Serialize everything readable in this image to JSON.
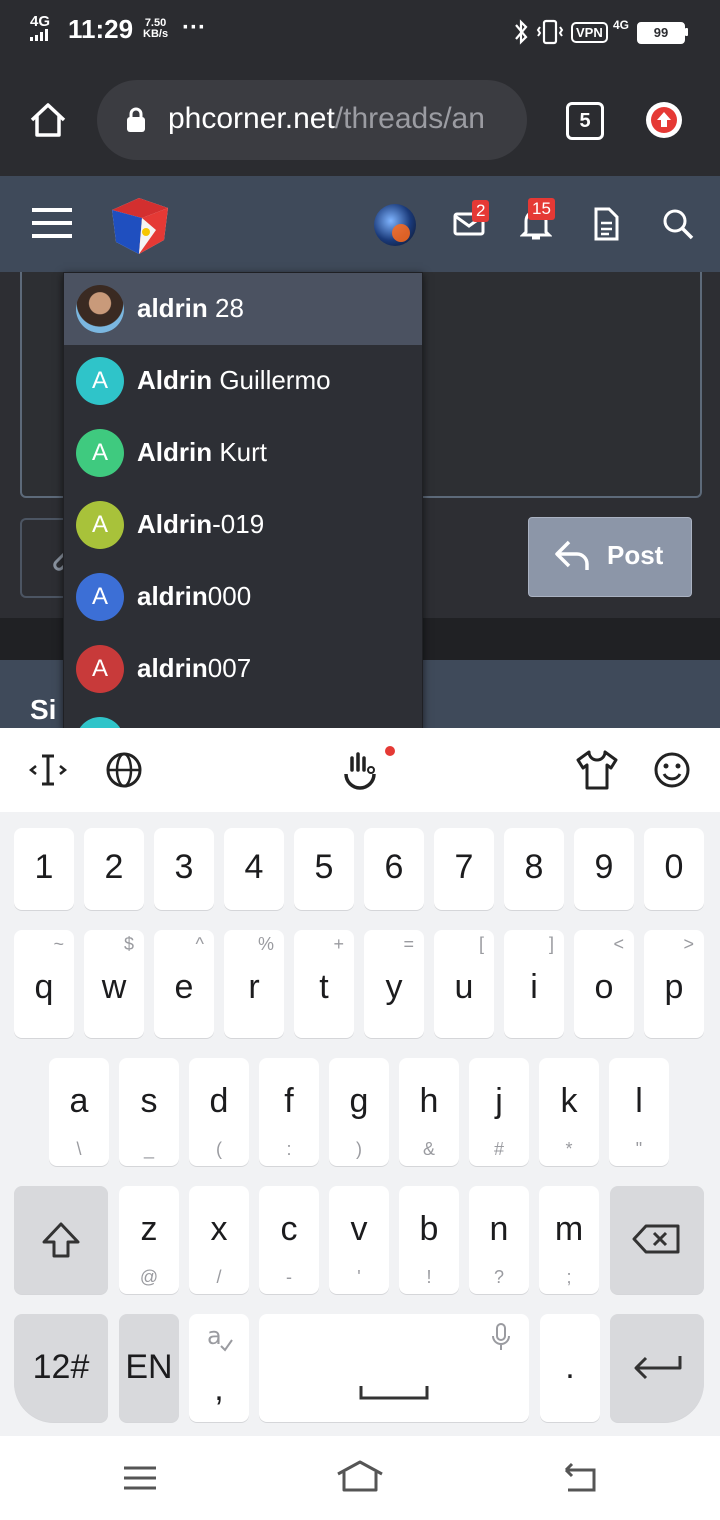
{
  "status_bar": {
    "signal_label": "4G",
    "time": "11:29",
    "speed_value": "7.50",
    "speed_unit": "KB/s",
    "more": "···",
    "vpn": "VPN",
    "network": "4G",
    "battery": "99"
  },
  "browser": {
    "url_domain": "phcorner.net",
    "url_path": "/threads/an",
    "tab_count": "5"
  },
  "site_header": {
    "messages_badge": "2",
    "alerts_badge": "15"
  },
  "editor": {
    "post_label": "Post",
    "similar_label": "Si"
  },
  "mentions": [
    {
      "bold": "aldrin",
      "rest": " 28",
      "initial": "",
      "avatar_color": "#7a5a48",
      "has_photo": true
    },
    {
      "bold": "Aldrin",
      "rest": " Guillermo",
      "initial": "A",
      "avatar_color": "#2fc4c9"
    },
    {
      "bold": "Aldrin",
      "rest": " Kurt",
      "initial": "A",
      "avatar_color": "#3fca7f"
    },
    {
      "bold": "Aldrin",
      "rest": "-019",
      "initial": "A",
      "avatar_color": "#a8c23a"
    },
    {
      "bold": "aldrin",
      "rest": "000",
      "initial": "A",
      "avatar_color": "#3c6fd6"
    },
    {
      "bold": "aldrin",
      "rest": "007",
      "initial": "A",
      "avatar_color": "#c83a3a"
    },
    {
      "bold": "",
      "rest": "",
      "initial": "",
      "avatar_color": "#2fc4c9"
    }
  ],
  "keyboard": {
    "numbers": [
      "1",
      "2",
      "3",
      "4",
      "5",
      "6",
      "7",
      "8",
      "9",
      "0"
    ],
    "row1": [
      {
        "k": "q",
        "s": "~"
      },
      {
        "k": "w",
        "s": "$"
      },
      {
        "k": "e",
        "s": "^"
      },
      {
        "k": "r",
        "s": "%"
      },
      {
        "k": "t",
        "s": "+"
      },
      {
        "k": "y",
        "s": "="
      },
      {
        "k": "u",
        "s": "["
      },
      {
        "k": "i",
        "s": "]"
      },
      {
        "k": "o",
        "s": "<"
      },
      {
        "k": "p",
        "s": ">"
      }
    ],
    "row2": [
      {
        "k": "a",
        "s": "\\"
      },
      {
        "k": "s",
        "s": "_"
      },
      {
        "k": "d",
        "s": "("
      },
      {
        "k": "f",
        "s": ":"
      },
      {
        "k": "g",
        "s": ")"
      },
      {
        "k": "h",
        "s": "&"
      },
      {
        "k": "j",
        "s": "#"
      },
      {
        "k": "k",
        "s": "*"
      },
      {
        "k": "l",
        "s": "\""
      }
    ],
    "row3": [
      {
        "k": "z",
        "s": "@"
      },
      {
        "k": "x",
        "s": "/"
      },
      {
        "k": "c",
        "s": "-"
      },
      {
        "k": "v",
        "s": "'"
      },
      {
        "k": "b",
        "s": "!"
      },
      {
        "k": "n",
        "s": "?"
      },
      {
        "k": "m",
        "s": ";"
      }
    ],
    "symbols_label": "12#",
    "language_label": "EN",
    "comma_label": ",",
    "period_label": ".",
    "accent_color": "#e53935"
  }
}
